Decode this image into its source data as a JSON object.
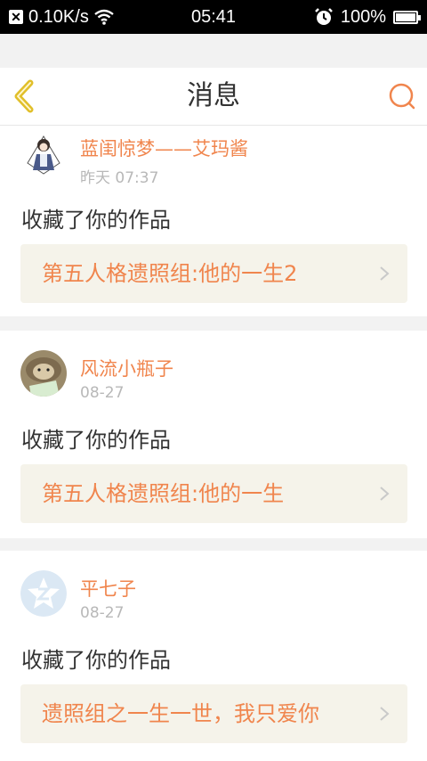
{
  "status_bar": {
    "net_speed": "0.10K/s",
    "time": "05:41",
    "battery": "100%",
    "battery_level": 1.0
  },
  "header": {
    "title": "消息",
    "back_icon": "chevron-left-icon",
    "search_icon": "search-icon"
  },
  "colors": {
    "accent": "#f0854d",
    "back_icon": "#e1bf2a",
    "work_bg": "#f5f3ea"
  },
  "messages": [
    {
      "username": "蓝闺惊梦——艾玛酱",
      "time": "昨天 07:37",
      "action": "收藏了你的作品",
      "work_title": "第五人格遗照组:他的一生2"
    },
    {
      "username": "风流小瓶子",
      "time": "08-27",
      "action": "收藏了你的作品",
      "work_title": "第五人格遗照组:他的一生"
    },
    {
      "username": "平七子",
      "time": "08-27",
      "action": "收藏了你的作品",
      "work_title": "遗照组之一生一世，我只爱你"
    }
  ]
}
